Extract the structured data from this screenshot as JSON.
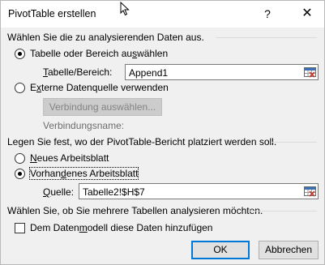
{
  "window": {
    "title": "PivotTable erstellen",
    "help_label": "?",
    "close_label": "✕"
  },
  "section1": {
    "heading": "Wählen Sie die zu analysierenden Daten aus.",
    "option_table": {
      "pre": "Tabelle oder Bereich au",
      "u": "s",
      "post": "wählen",
      "checked": true
    },
    "range": {
      "label_u": "T",
      "label_rest": "abelle/Bereich:",
      "value": "Append1"
    },
    "option_external": {
      "pre": "E",
      "u": "x",
      "post": "terne Datenquelle verwenden",
      "checked": false
    },
    "connection_button": "Verbindung auswählen...",
    "connection_name_label": "Verbindungsname:"
  },
  "section2": {
    "heading": "Legen Sie fest, wo der PivotTable-Bericht platziert werden soll.",
    "option_new": {
      "u": "N",
      "post": "eues Arbeitsblatt",
      "checked": false
    },
    "option_existing": {
      "pre": "Vorhan",
      "u": "d",
      "post": "enes Arbeitsblatt",
      "checked": true
    },
    "source": {
      "label_u": "Q",
      "label_rest": "uelle:",
      "value": "Tabelle2!$H$7"
    }
  },
  "section3": {
    "heading": "Wählen Sie, ob Sie mehrere Tabellen analysieren möchten.",
    "checkbox": {
      "pre": "Dem Daten",
      "u": "m",
      "post": "odell diese Daten hinzufügen",
      "checked": false
    }
  },
  "buttons": {
    "ok": "OK",
    "cancel": "Abbrechen"
  },
  "icons": {
    "range_picker": "range-picker-icon",
    "cursor": "mouse-cursor-icon"
  }
}
